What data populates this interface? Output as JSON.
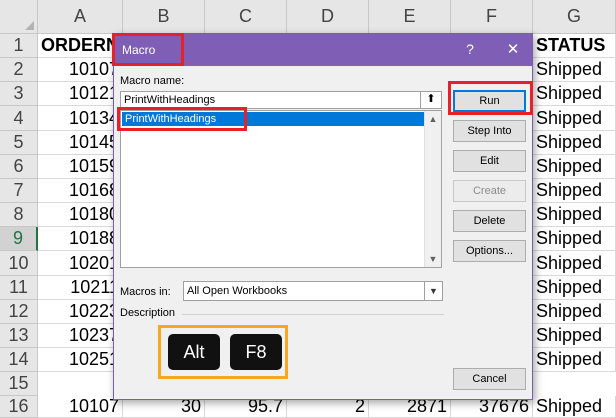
{
  "spreadsheet": {
    "columns": [
      "A",
      "B",
      "C",
      "D",
      "E",
      "F",
      "G"
    ],
    "rows": [
      "1",
      "2",
      "3",
      "4",
      "5",
      "6",
      "7",
      "8",
      "9",
      "10",
      "11",
      "12",
      "13",
      "14",
      "15",
      "16"
    ],
    "header_row": {
      "a": "ORDERNU",
      "g": "STATUS"
    },
    "column_a": [
      "10107",
      "10121",
      "10134",
      "10145",
      "10159",
      "10168",
      "10180",
      "10188",
      "10201",
      "10211",
      "10223",
      "10237",
      "10251"
    ],
    "column_g": [
      "Shipped",
      "Shipped",
      "Shipped",
      "Shipped",
      "Shipped",
      "Shipped",
      "Shipped",
      "Shipped",
      "Shipped",
      "Shipped",
      "Shipped",
      "Shipped",
      "Shipped"
    ],
    "last_row": {
      "a": "10107",
      "b": "30",
      "c": "95.7",
      "d": "2",
      "e": "2871",
      "f": "37676",
      "g": "Shipped"
    }
  },
  "dialog": {
    "title": "Macro",
    "help_icon": "?",
    "close_icon": "✕",
    "macro_name_label": "Macro name:",
    "macro_name_value": "PrintWithHeadings",
    "macros": [
      "PrintWithHeadings"
    ],
    "buttons": {
      "run": "Run",
      "step_into": "Step Into",
      "edit": "Edit",
      "create": "Create",
      "delete": "Delete",
      "options": "Options...",
      "cancel": "Cancel"
    },
    "macros_in_label": "Macros in:",
    "macros_in_value": "All Open Workbooks",
    "description_label": "Description"
  },
  "shortcut": {
    "key1": "Alt",
    "key2": "F8"
  },
  "colors": {
    "titlebar": "#7f5fb6",
    "highlight_red": "#e8202a",
    "highlight_orange": "#f5a623",
    "selection": "#0078d7"
  }
}
